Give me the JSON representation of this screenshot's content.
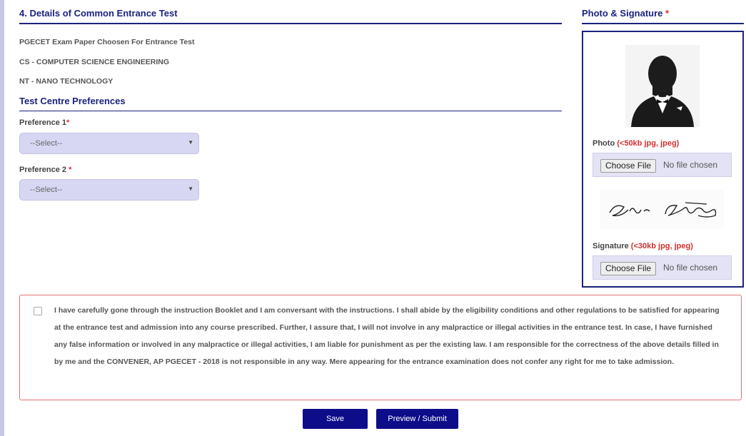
{
  "section4": {
    "title": "4. Details of Common Entrance Test",
    "exam_paper_heading": "PGECET Exam Paper Choosen For Entrance Test",
    "papers": [
      "CS - COMPUTER SCIENCE ENGINEERING",
      "NT - NANO TECHNOLOGY"
    ]
  },
  "test_centre": {
    "title": "Test Centre Preferences",
    "pref1_label": "Preference 1",
    "pref1_value": "--Select--",
    "pref2_label": "Preference 2",
    "pref2_value": "--Select--",
    "required_mark": "*"
  },
  "photo_signature": {
    "title": "Photo & Signature",
    "required_mark": "*",
    "photo_label": "Photo",
    "photo_hint": "(<50kb jpg, jpeg)",
    "signature_label": "Signature",
    "signature_hint": "(<30kb jpg, jpeg)",
    "choose_file": "Choose File",
    "no_file": "No file chosen",
    "signature_text": "Elvis Gaskell"
  },
  "declaration": {
    "checked": false,
    "text": "I have carefully gone through the instruction Booklet and I am conversant with the instructions. I shall abide by the eligibility conditions and other regulations to be satisfied for appearing at the entrance test and admission into any course prescribed. Further, I assure that, I will not involve in any malpractice or illegal activities in the entrance test. In case, I have furnished any false information or involved in any malpractice or illegal activities, I am liable for punishment as per the existing law. I am responsible for the correctness of the above details filled in by me and the CONVENER, AP PGECET - 2018 is not responsible in any way. Mere appearing for the entrance examination does not confer any right for me to take admission."
  },
  "actions": {
    "save": "Save",
    "preview_submit": "Preview / Submit"
  },
  "colors": {
    "heading": "#1a237e",
    "required": "#d32f2f",
    "button": "#0d0d8a",
    "select_bg": "#d8d7f3"
  }
}
